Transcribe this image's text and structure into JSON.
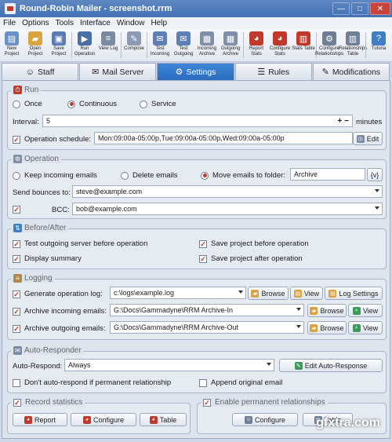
{
  "window": {
    "title": "Round-Robin Mailer - screenshot.rrm",
    "minimize": "—",
    "maximize": "□",
    "close": "✕"
  },
  "menu": [
    "File",
    "Options",
    "Tools",
    "Interface",
    "Window",
    "Help"
  ],
  "toolbar": [
    {
      "label": "New Project",
      "icon": "new-project-icon",
      "color": "#6b8fc7",
      "glyph": "▤"
    },
    {
      "label": "Open Project",
      "icon": "open-project-icon",
      "color": "#d9a441",
      "glyph": "▰"
    },
    {
      "label": "Save Project",
      "icon": "save-project-icon",
      "color": "#5a7bb5",
      "glyph": "▣"
    },
    {
      "label": "Run Operation",
      "icon": "run-operation-icon",
      "color": "#4a6fa5",
      "glyph": "▶"
    },
    {
      "label": "View Log",
      "icon": "view-log-icon",
      "color": "#7a8aa3",
      "glyph": "≡"
    },
    {
      "label": "Compose",
      "icon": "compose-icon",
      "color": "#8c9bb3",
      "glyph": "✎"
    },
    {
      "label": "Test Incoming",
      "icon": "test-incoming-icon",
      "color": "#5d7fb3",
      "glyph": "✉"
    },
    {
      "label": "Test Outgoing",
      "icon": "test-outgoing-icon",
      "color": "#5d7fb3",
      "glyph": "✉"
    },
    {
      "label": "Incoming Archive",
      "icon": "incoming-archive-icon",
      "color": "#7f8fa8",
      "glyph": "▦"
    },
    {
      "label": "Outgoing Archive",
      "icon": "outgoing-archive-icon",
      "color": "#7f8fa8",
      "glyph": "▦"
    },
    {
      "label": "Report Stats",
      "icon": "report-stats-icon",
      "color": "#c0392b",
      "glyph": "◕"
    },
    {
      "label": "Configure Stats",
      "icon": "configure-stats-icon",
      "color": "#c0392b",
      "glyph": "◕"
    },
    {
      "label": "Stats Table",
      "icon": "stats-table-icon",
      "color": "#c0392b",
      "glyph": "▥"
    },
    {
      "label": "Configure Relationships",
      "icon": "configure-relationships-icon",
      "color": "#6f7f96",
      "glyph": "⚙"
    },
    {
      "label": "Relationships Table",
      "icon": "relationships-table-icon",
      "color": "#6f7f96",
      "glyph": "▥"
    },
    {
      "label": "Tutoria",
      "icon": "tutorial-icon",
      "color": "#3f7dc4",
      "glyph": "?"
    }
  ],
  "tabs": [
    {
      "label": "Staff",
      "icon": "staff-icon",
      "glyph": "☺"
    },
    {
      "label": "Mail Server",
      "icon": "mail-server-icon",
      "glyph": "✉"
    },
    {
      "label": "Settings",
      "icon": "settings-icon",
      "glyph": "⚙"
    },
    {
      "label": "Rules",
      "icon": "rules-icon",
      "glyph": "☰"
    },
    {
      "label": "Modifications",
      "icon": "modifications-icon",
      "glyph": "✎"
    }
  ],
  "run": {
    "label": "Run",
    "modes": [
      "Once",
      "Continuous",
      "Service"
    ],
    "selected_mode": "Continuous",
    "interval_label": "Interval:",
    "interval_value": "5",
    "interval_unit": "minutes",
    "schedule_label": "Operation schedule:",
    "schedule_value": "Mon:09:00a-05:00p,Tue:09:00a-05:00p,Wed:09:00a-05:00p",
    "edit_label": "Edit"
  },
  "operation": {
    "label": "Operation",
    "keep": "Keep incoming emails",
    "delete": "Delete emails",
    "move": "Move emails to folder:",
    "folder": "Archive",
    "folder_btn": "{v}",
    "bounces_label": "Send bounces to:",
    "bounces_value": "steve@example.com",
    "bcc_label": "BCC:",
    "bcc_value": "bob@example.com"
  },
  "before_after": {
    "label": "Before/After",
    "test_outgoing": "Test outgoing server before operation",
    "display_summary": "Display summary",
    "save_before": "Save project before operation",
    "save_after": "Save project after operation"
  },
  "logging": {
    "label": "Logging",
    "gen_log": "Generate operation log:",
    "gen_log_value": "c:\\logs\\example.log",
    "archive_in": "Archive incoming emails:",
    "archive_in_value": "G:\\Docs\\Gammadyne\\RRM Archive-In",
    "archive_out": "Archive outgoing emails:",
    "archive_out_value": "G:\\Docs\\Gammadyne\\RRM Archive-Out",
    "browse": "Browse",
    "view": "View",
    "log_settings": "Log Settings"
  },
  "auto_responder": {
    "label": "Auto-Responder",
    "auto_respond_label": "Auto-Respond:",
    "auto_respond_value": "Always",
    "edit_btn": "Edit Auto-Response",
    "dont_auto": "Don't auto-respond if permanent relationship",
    "append": "Append original email"
  },
  "stats": {
    "label": "Record statistics",
    "report": "Report",
    "configure": "Configure",
    "table": "Table"
  },
  "relationships": {
    "label": "Enable permanent relationships",
    "configure": "Configure",
    "table": "Table"
  },
  "watermark": "gfxtra.com",
  "colors": {
    "accent": "#2a6cc0",
    "check": "#c0392b",
    "title": "#4272b5"
  }
}
